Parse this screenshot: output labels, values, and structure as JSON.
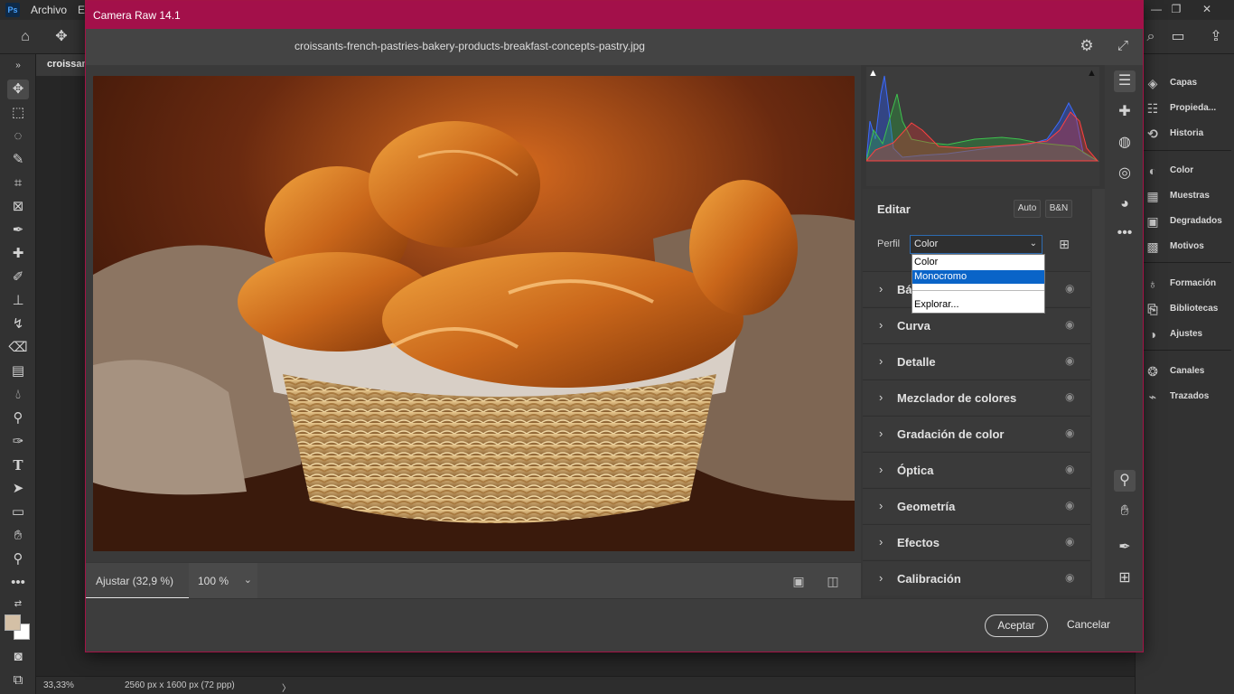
{
  "photoshop": {
    "menu": {
      "logo": "Ps",
      "items": [
        "Archivo",
        "E"
      ]
    },
    "document_tab": "croissants",
    "status": {
      "zoom": "33,33%",
      "doc_info": "2560 px x 1600 px (72 ppp)",
      "arrow": "〉"
    },
    "panels": [
      {
        "label": "Capas",
        "icon": "layers-icon"
      },
      {
        "label": "Propieda...",
        "icon": "properties-icon"
      },
      {
        "label": "Historia",
        "icon": "history-icon"
      },
      {
        "label": "Color",
        "icon": "color-icon"
      },
      {
        "label": "Muestras",
        "icon": "swatches-icon"
      },
      {
        "label": "Degradados",
        "icon": "gradients-icon"
      },
      {
        "label": "Motivos",
        "icon": "patterns-icon"
      },
      {
        "label": "Formación",
        "icon": "learn-icon"
      },
      {
        "label": "Bibliotecas",
        "icon": "libraries-icon"
      },
      {
        "label": "Ajustes",
        "icon": "adjustments-icon"
      },
      {
        "label": "Canales",
        "icon": "channels-icon"
      },
      {
        "label": "Trazados",
        "icon": "paths-icon"
      }
    ]
  },
  "camera_raw": {
    "title": "Camera Raw 14.1",
    "filename": "croissants-french-pastries-bakery-products-breakfast-concepts-pastry.jpg",
    "fit_label": "Ajustar (32,9 %)",
    "zoom_value": "100 %",
    "edit": {
      "title": "Editar",
      "auto_label": "Auto",
      "bw_label": "B&N",
      "profile_label": "Perfil",
      "profile_value": "Color",
      "profile_options": [
        "Color",
        "Monocromo",
        "",
        "Explorar..."
      ],
      "profile_selected_option": "Monocromo"
    },
    "sections": [
      {
        "label": "Básico",
        "visible_label": "Bá"
      },
      {
        "label": "Curva",
        "visible_label": "Curva"
      },
      {
        "label": "Detalle",
        "visible_label": "Detalle"
      },
      {
        "label": "Mezclador de colores",
        "visible_label": "Mezclador de colores"
      },
      {
        "label": "Gradación de color",
        "visible_label": "Gradación de color"
      },
      {
        "label": "Óptica",
        "visible_label": "Óptica"
      },
      {
        "label": "Geometría",
        "visible_label": "Geometría"
      },
      {
        "label": "Efectos",
        "visible_label": "Efectos"
      },
      {
        "label": "Calibración",
        "visible_label": "Calibración"
      }
    ],
    "accept_label": "Aceptar",
    "cancel_label": "Cancelar"
  },
  "colors": {
    "dialog_titlebar": "#a3104a",
    "selection_blue": "#0a64c8",
    "fg_color": "#d4c0a6",
    "bg_color": "#ffffff"
  }
}
